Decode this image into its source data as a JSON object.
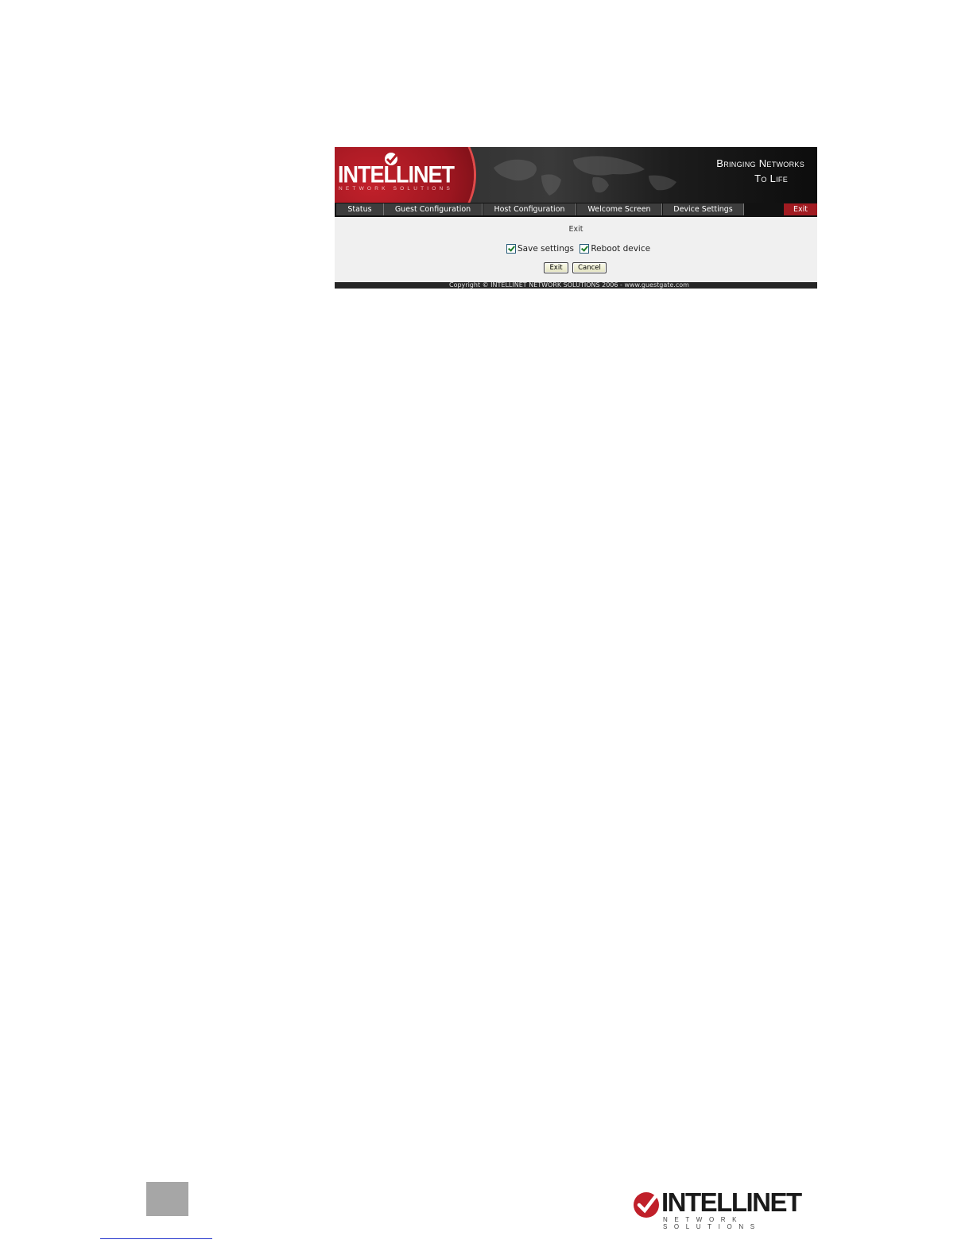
{
  "banner": {
    "logo_text": "INTELLINET",
    "logo_sub": "NETWORK SOLUTIONS",
    "tagline_line1": "Bringing Networks",
    "tagline_line2": "To Life"
  },
  "nav": {
    "tabs": [
      {
        "label": "Status"
      },
      {
        "label": "Guest Configuration"
      },
      {
        "label": "Host Configuration"
      },
      {
        "label": "Welcome Screen"
      },
      {
        "label": "Device Settings"
      }
    ],
    "exit_label": "Exit"
  },
  "content": {
    "heading": "Exit",
    "checkboxes": [
      {
        "label": "Save settings",
        "checked": true
      },
      {
        "label": "Reboot device",
        "checked": true
      }
    ],
    "buttons": {
      "exit": "Exit",
      "cancel": "Cancel"
    }
  },
  "footer": {
    "copyright": "Copyright © INTELLINET NETWORK SOLUTIONS 2006 - www.guestgate.com"
  },
  "page_footer": {
    "logo_text": "INTELLINET",
    "logo_sub": "NETWORK SOLUTIONS"
  },
  "colors": {
    "brand_red": "#a11b21",
    "nav_dark": "#121212",
    "content_bg": "#f0f0f0"
  }
}
